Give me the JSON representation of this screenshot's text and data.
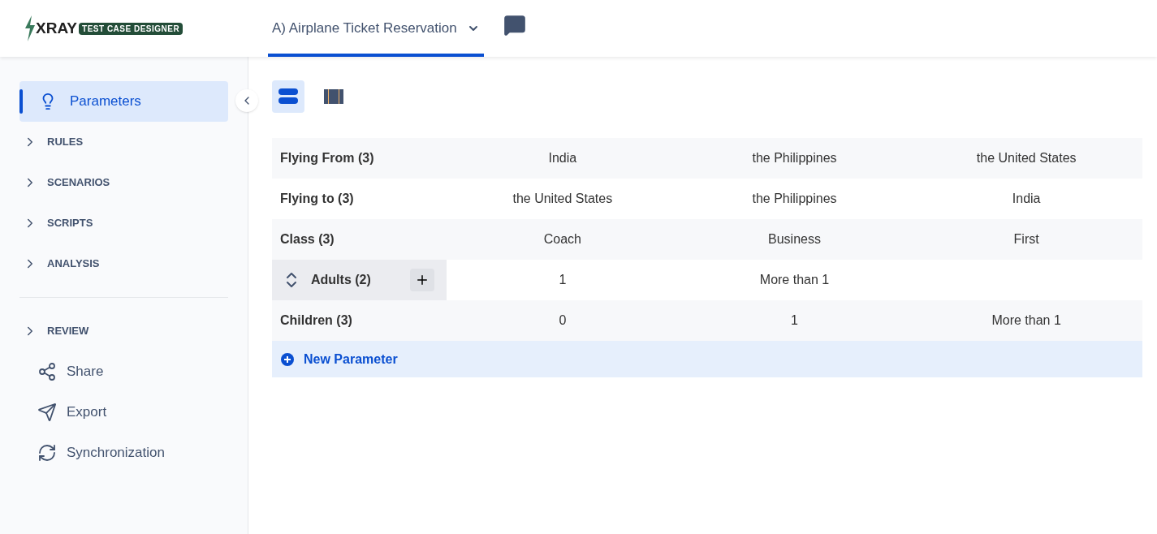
{
  "logo": {
    "brand": "XRAY",
    "product": "TEST CASE DESIGNER"
  },
  "tabs": [
    {
      "label": "A) Airplane Ticket Reservation",
      "selected": true
    }
  ],
  "view_toggles": [
    {
      "kind": "rows",
      "selected": true
    },
    {
      "kind": "columns",
      "selected": false
    }
  ],
  "sidebar": {
    "items": [
      {
        "kind": "active",
        "label": "Parameters",
        "selected": true
      },
      {
        "kind": "section",
        "label": "RULES",
        "selected": false
      },
      {
        "kind": "section",
        "label": "SCENARIOS",
        "selected": false
      },
      {
        "kind": "section",
        "label": "SCRIPTS",
        "selected": false
      },
      {
        "kind": "section",
        "label": "ANALYSIS",
        "selected": false
      },
      {
        "kind": "divider"
      },
      {
        "kind": "section",
        "label": "REVIEW",
        "selected": false
      },
      {
        "kind": "share",
        "label": "Share",
        "selected": false
      },
      {
        "kind": "export",
        "label": "Export",
        "selected": false
      },
      {
        "kind": "sync",
        "label": "Synchronization",
        "selected": false
      }
    ]
  },
  "parameters": [
    {
      "name": "Flying From (3)",
      "hovered": false,
      "values": [
        "India",
        "the Philippines",
        "the United States"
      ]
    },
    {
      "name": "Flying to (3)",
      "hovered": false,
      "values": [
        "the United States",
        "the Philippines",
        "India"
      ]
    },
    {
      "name": "Class (3)",
      "hovered": false,
      "values": [
        "Coach",
        "Business",
        "First"
      ]
    },
    {
      "name": "Adults (2)",
      "hovered": true,
      "values": [
        "1",
        "More than 1"
      ]
    },
    {
      "name": "Children (3)",
      "hovered": false,
      "values": [
        "0",
        "1",
        "More than 1"
      ]
    }
  ],
  "new_parameter": "New Parameter"
}
